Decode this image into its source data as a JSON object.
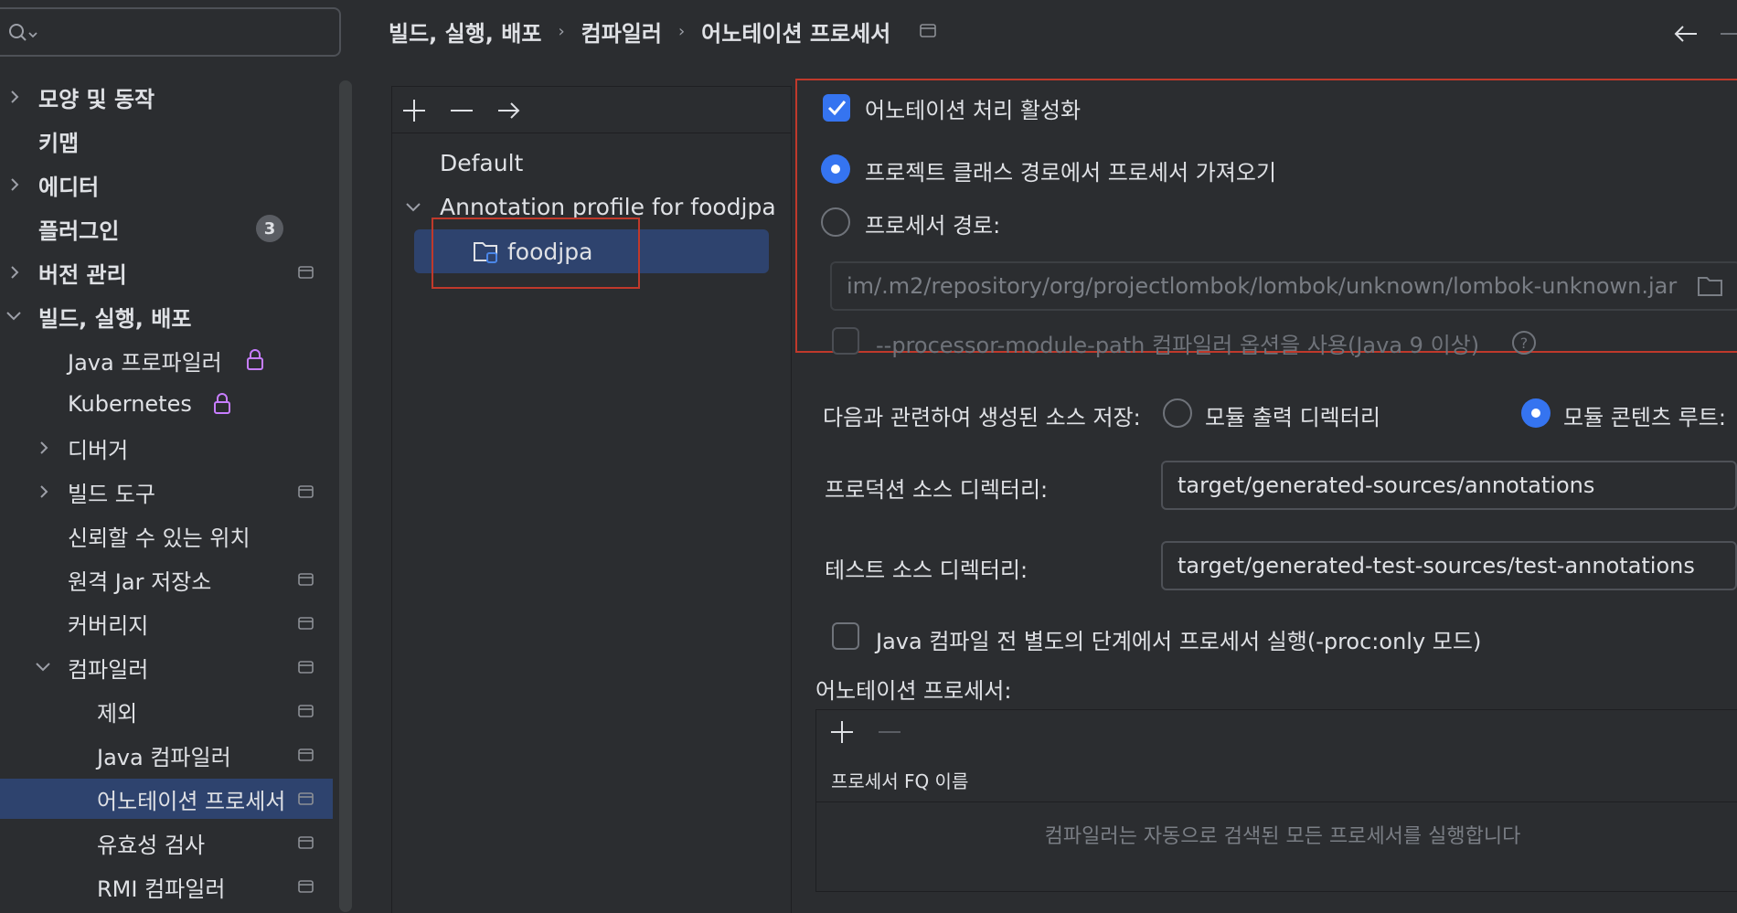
{
  "search": {
    "icon": "search-icon"
  },
  "sidebar": {
    "items": [
      {
        "label": "모양 및 동작",
        "chevron": "right"
      },
      {
        "label": "키맵"
      },
      {
        "label": "에디터",
        "chevron": "right"
      },
      {
        "label": "플러그인",
        "badge": "3"
      },
      {
        "label": "버전 관리",
        "chevron": "right"
      },
      {
        "label": "빌드, 실행, 배포",
        "chevron": "down"
      },
      {
        "label": "Java 프로파일러"
      },
      {
        "label": "Kubernetes"
      },
      {
        "label": "디버거",
        "chevron": "right"
      },
      {
        "label": "빌드 도구",
        "chevron": "right"
      },
      {
        "label": "신뢰할 수 있는 위치"
      },
      {
        "label": "원격 Jar 저장소"
      },
      {
        "label": "커버리지"
      },
      {
        "label": "컴파일러",
        "chevron": "down"
      },
      {
        "label": "제외"
      },
      {
        "label": "Java 컴파일러"
      },
      {
        "label": "어노테이션 프로세서",
        "selected": true
      },
      {
        "label": "유효성 검사"
      },
      {
        "label": "RMI 컴파일러"
      }
    ]
  },
  "breadcrumb": {
    "items": [
      "빌드, 실행, 배포",
      "컴파일러",
      "어노테이션 프로세서"
    ],
    "separator": "›"
  },
  "profiles": {
    "items": [
      {
        "label": "Default"
      },
      {
        "label": "Annotation profile for foodjpa",
        "expanded": true
      },
      {
        "label": "foodjpa",
        "selected": true
      }
    ]
  },
  "settings": {
    "enable_processing": {
      "label": "어노테이션 처리 활성화",
      "checked": true
    },
    "obtain_from_classpath": {
      "label": "프로젝트 클래스 경로에서 프로세서 가져오기",
      "selected": true
    },
    "processor_path": {
      "label": "프로세서 경로:",
      "selected": false
    },
    "processor_path_value": "im/.m2/repository/org/projectlombok/lombok/unknown/lombok-unknown.jar",
    "module_path_option": {
      "label": "--processor-module-path 컴파일러 옵션을 사용(Java 9 이상)",
      "checked": false
    },
    "store_generated": {
      "label": "다음과 관련하여 생성된 소스 저장:",
      "option_output": "모듈 출력 디렉터리",
      "option_content_root": "모듈 콘텐츠 루트:",
      "selected": "모듈 콘텐츠 루트:"
    },
    "production_dir": {
      "label": "프로덕션 소스 디렉터리:",
      "value": "target/generated-sources/annotations"
    },
    "test_dir": {
      "label": "테스트 소스 디렉터리:",
      "value": "target/generated-test-sources/test-annotations"
    },
    "proc_only": {
      "label": "Java 컴파일 전 별도의 단계에서 프로세서 실행(-proc:only 모드)",
      "checked": false
    },
    "processors": {
      "label": "어노테이션 프로세서:",
      "column_header": "프로세서 FQ 이름",
      "empty_text": "컴파일러는 자동으로 검색된 모든 프로세서를 실행합니다"
    }
  },
  "colors": {
    "background": "#2b2d30",
    "selection": "#2e436e",
    "accent": "#3574f0",
    "highlight_frame": "#c0392b"
  }
}
